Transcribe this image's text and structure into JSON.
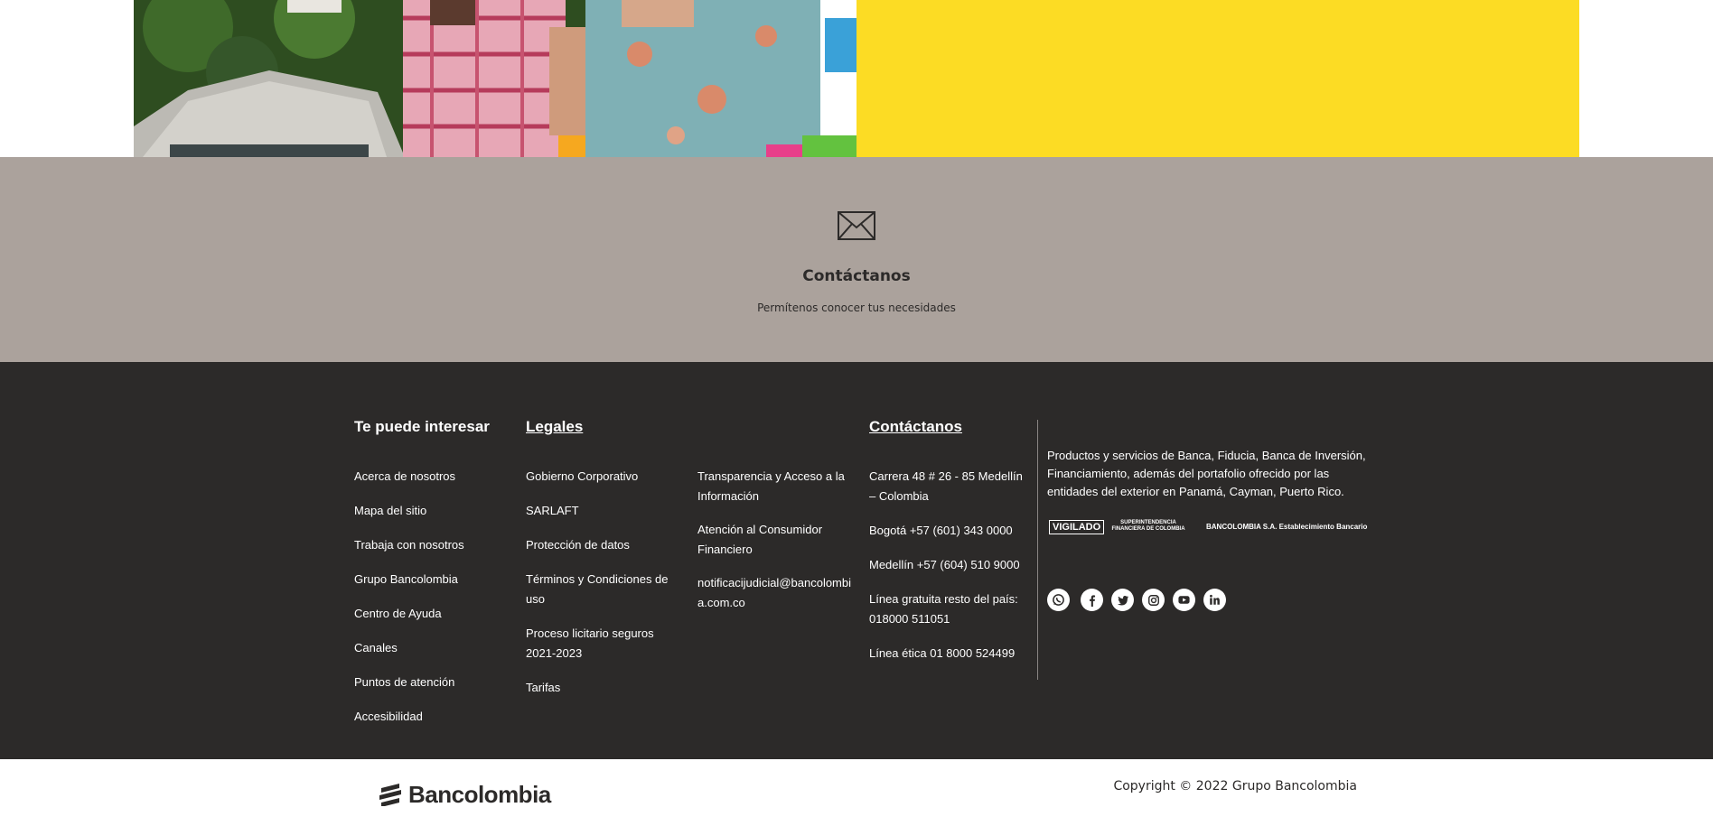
{
  "contact_band": {
    "icon": "mail-icon",
    "title": "Contáctanos",
    "subtitle": "Permítenos conocer tus necesidades"
  },
  "footer": {
    "interest": {
      "title": "Te puede interesar",
      "items": [
        "Acerca de nosotros",
        "Mapa del sitio",
        "Trabaja con nosotros",
        "Grupo Bancolombia",
        "Centro de Ayuda",
        "Canales",
        "Puntos de atención",
        "Accesibilidad"
      ]
    },
    "legal": {
      "title": "Legales",
      "items": [
        "Gobierno Corporativo",
        "SARLAFT",
        "Protección de datos",
        "Términos y Condiciones de uso",
        "Proceso licitario seguros 2021-2023",
        "Tarifas"
      ],
      "items2": [
        "Transparencia y Acceso a la Información",
        "Atención al Consumidor Financiero",
        "notificacijudicial@bancolombia.com.co"
      ]
    },
    "contact": {
      "title": "Contáctanos",
      "items": [
        "Carrera 48 # 26 - 85 Medellín – Colombia",
        "Bogotá +57 (601) 343 0000",
        "Medellín +57 (604) 510 9000",
        "Línea gratuita resto del país: 018000 511051",
        "Línea ética 01 8000 524499"
      ]
    },
    "about": "Productos y servicios de Banca, Fiducia, Banca de Inversión, Financiamiento, además del portafolio ofrecido por las entidades del exterior en Panamá, Cayman, Puerto Rico.",
    "vigilado": {
      "badge": "VIGILADO",
      "supervisor": "SUPERINTENDENCIA FINANCIERA DE COLOMBIA",
      "bank": "BANCOLOMBIA S.A. Establecimiento Bancario"
    },
    "social": [
      "whatsapp-icon",
      "facebook-icon",
      "twitter-icon",
      "instagram-icon",
      "youtube-icon",
      "linkedin-icon"
    ]
  },
  "bottom": {
    "logo_text": "Bancolombia",
    "copyright": "Copyright © 2022 Grupo Bancolombia"
  }
}
